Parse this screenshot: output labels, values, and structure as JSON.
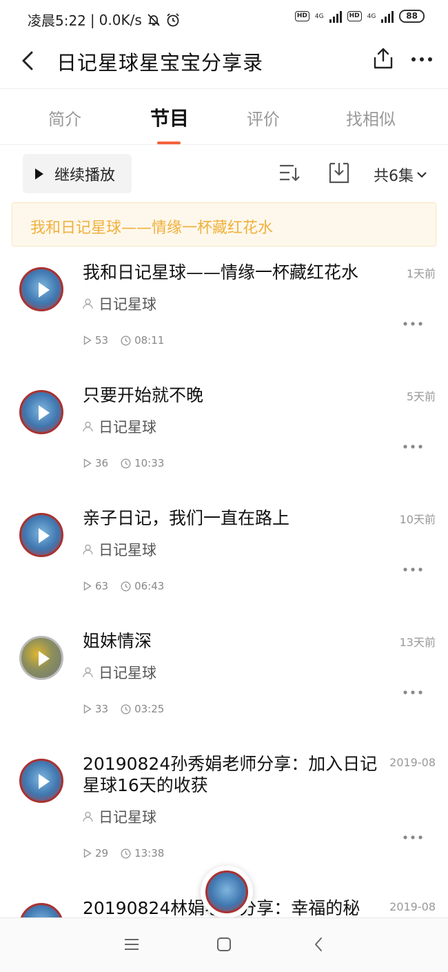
{
  "status_bar": {
    "time": "凌晨5:22",
    "net_speed": "0.0K/s",
    "hd1": "HD",
    "net1": "4G",
    "hd2": "HD",
    "net2": "4G",
    "battery": "88"
  },
  "header": {
    "title": "日记星球星宝宝分享录"
  },
  "tabs": [
    {
      "label": "简介"
    },
    {
      "label": "节目"
    },
    {
      "label": "评价"
    },
    {
      "label": "找相似"
    }
  ],
  "toolbar": {
    "continue_label": "继续播放",
    "count_label": "共6集"
  },
  "now_playing": {
    "title": "我和日记星球——情缘一杯藏红花水"
  },
  "episodes": [
    {
      "title": "我和日记星球——情缘一杯藏红花水",
      "time": "1天前",
      "author": "日记星球",
      "plays": "53",
      "duration": "08:11",
      "cover": "logo"
    },
    {
      "title": "只要开始就不晚",
      "time": "5天前",
      "author": "日记星球",
      "plays": "36",
      "duration": "10:33",
      "cover": "logo"
    },
    {
      "title": "亲子日记，我们一直在路上",
      "time": "10天前",
      "author": "日记星球",
      "plays": "63",
      "duration": "06:43",
      "cover": "logo"
    },
    {
      "title": "姐妹情深",
      "time": "13天前",
      "author": "日记星球",
      "plays": "33",
      "duration": "03:25",
      "cover": "sunflower"
    },
    {
      "title": "20190824孙秀娟老师分享：加入日记星球16天的收获",
      "time": "2019-08",
      "author": "日记星球",
      "plays": "29",
      "duration": "13:38",
      "cover": "logo"
    },
    {
      "title": "20190824林娟老师分享：幸福的秘",
      "time": "2019-08",
      "cover": "logo"
    }
  ],
  "colors": {
    "accent": "#f5613c",
    "now_playing_text": "#f0b03c",
    "now_playing_bg": "#fef8ec"
  }
}
